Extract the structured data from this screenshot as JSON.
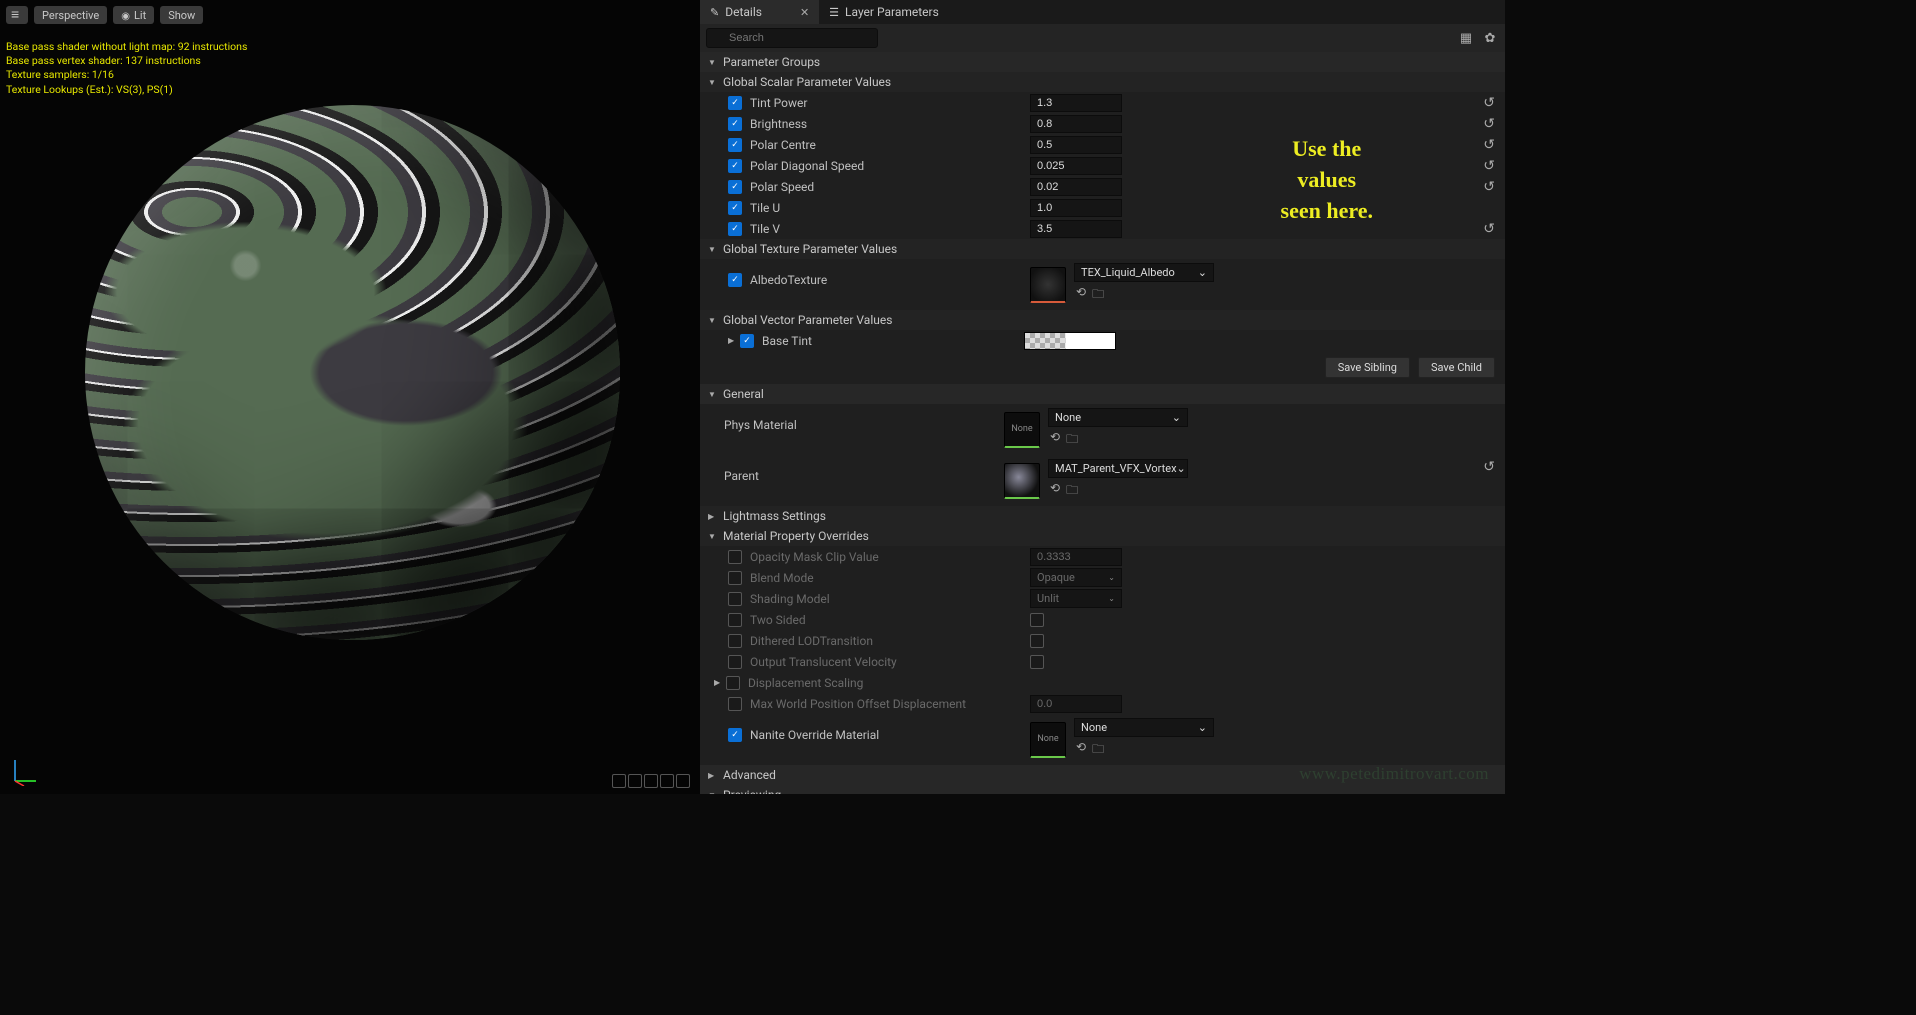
{
  "viewport": {
    "toolbar": {
      "perspective": "Perspective",
      "lit": "Lit",
      "show": "Show"
    },
    "stats": [
      "Base pass shader without light map: 92 instructions",
      "Base pass vertex shader: 137 instructions",
      "Texture samplers: 1/16",
      "Texture Lookups (Est.): VS(3), PS(1)"
    ],
    "watermark": "www.petedimitrovart.com"
  },
  "tabs": {
    "details": "Details",
    "layer_params": "Layer Parameters"
  },
  "search": {
    "placeholder": "Search"
  },
  "annotation": "Use the\nvalues\nseen here.",
  "groups": {
    "parameter_groups": "Parameter Groups",
    "global_scalar": "Global Scalar Parameter Values",
    "global_texture": "Global Texture Parameter Values",
    "global_vector": "Global Vector Parameter Values",
    "general": "General",
    "lightmass": "Lightmass Settings",
    "mat_override": "Material Property Overrides",
    "advanced": "Advanced",
    "previewing": "Previewing"
  },
  "scalar": {
    "tint_power": {
      "label": "Tint Power",
      "value": "1.3"
    },
    "brightness": {
      "label": "Brightness",
      "value": "0.8"
    },
    "polar_centre": {
      "label": "Polar Centre",
      "value": "0.5"
    },
    "polar_diag": {
      "label": "Polar Diagonal Speed",
      "value": "0.025"
    },
    "polar_speed": {
      "label": "Polar Speed",
      "value": "0.02"
    },
    "tile_u": {
      "label": "Tile U",
      "value": "1.0"
    },
    "tile_v": {
      "label": "Tile V",
      "value": "3.5"
    }
  },
  "texture": {
    "albedo": {
      "label": "AlbedoTexture",
      "asset": "TEX_Liquid_Albedo"
    }
  },
  "vector": {
    "base_tint": {
      "label": "Base Tint"
    }
  },
  "buttons": {
    "save_sibling": "Save Sibling",
    "save_child": "Save Child"
  },
  "general": {
    "phys": {
      "label": "Phys Material",
      "value": "None"
    },
    "parent": {
      "label": "Parent",
      "value": "MAT_Parent_VFX_Vortex"
    }
  },
  "overrides": {
    "opacity": {
      "label": "Opacity Mask Clip Value",
      "value": "0.3333"
    },
    "blend": {
      "label": "Blend Mode",
      "value": "Opaque"
    },
    "shading": {
      "label": "Shading Model",
      "value": "Unlit"
    },
    "two_sided": {
      "label": "Two Sided"
    },
    "dithered": {
      "label": "Dithered LODTransition"
    },
    "otv": {
      "label": "Output Translucent Velocity"
    },
    "disp": {
      "label": "Displacement Scaling"
    },
    "mwpo": {
      "label": "Max World Position Offset Displacement",
      "value": "0.0"
    },
    "nanite": {
      "label": "Nanite Override Material",
      "value": "None"
    }
  }
}
